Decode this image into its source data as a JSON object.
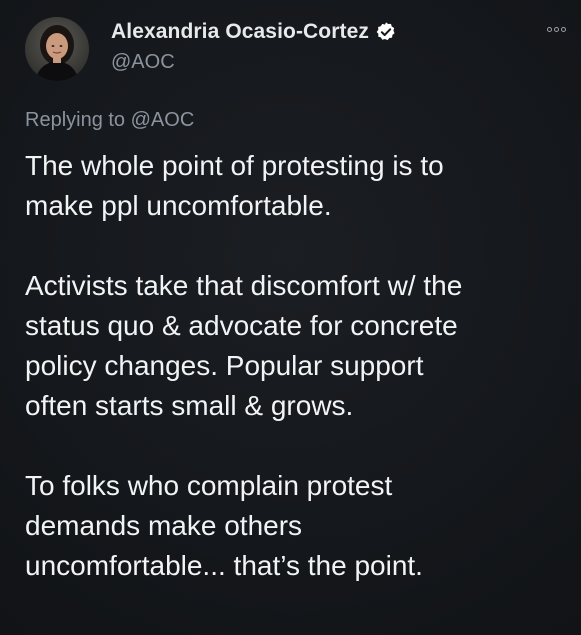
{
  "tweet": {
    "author": {
      "display_name": "Alexandria Ocasio-Cortez",
      "handle": "@AOC",
      "verified": true,
      "avatar_icon": "profile-photo"
    },
    "reply_prefix": "Replying to",
    "reply_mention": "@AOC",
    "paragraphs": [
      "The whole point of protesting is to\nmake ppl uncomfortable.",
      "Activists take that discomfort w/ the\nstatus quo & advocate for concrete\npolicy changes. Popular support\noften starts small & grows.",
      "To folks who complain protest\ndemands make others\nuncomfortable... that’s the point."
    ],
    "more_icon": "more-options-icon"
  },
  "colors": {
    "background": "#15181c",
    "text_primary": "#e7e9ea",
    "text_secondary": "#8b949e",
    "verified_badge": "#ffffff"
  }
}
